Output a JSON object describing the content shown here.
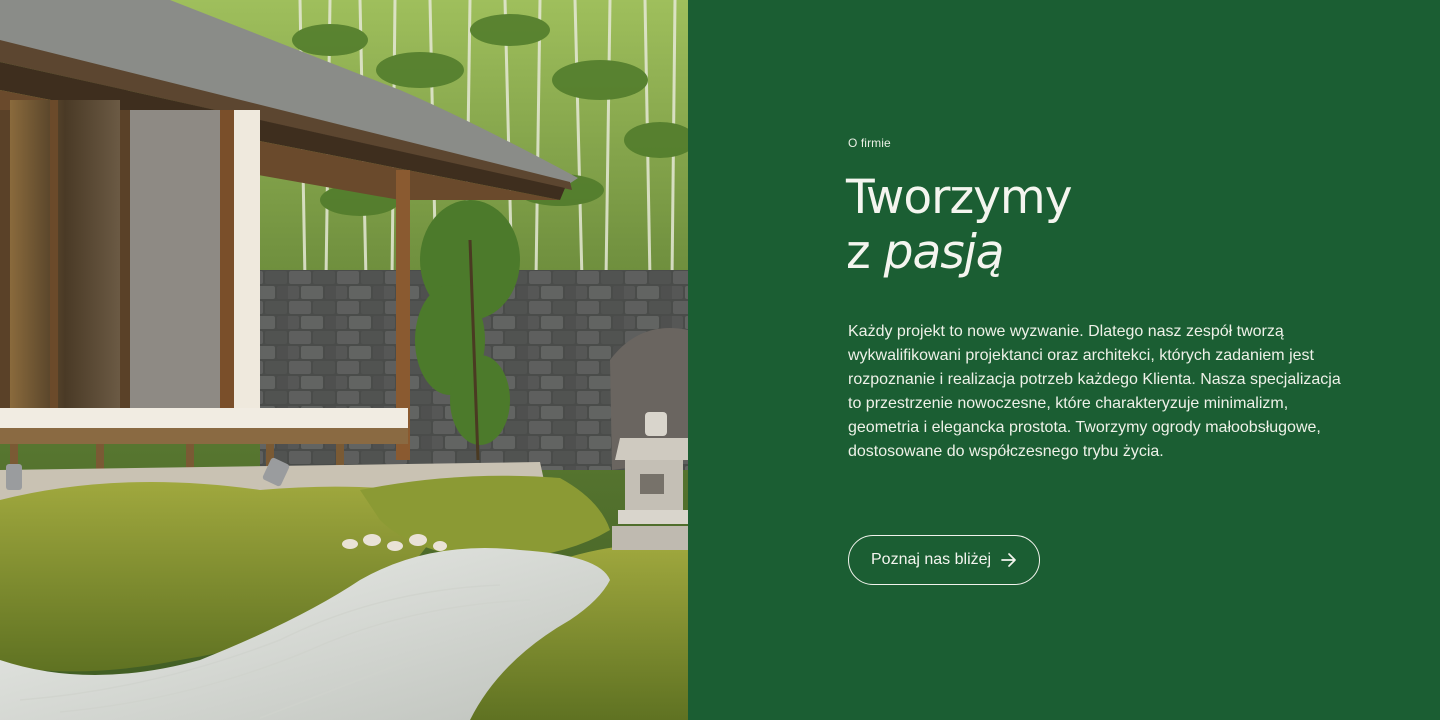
{
  "about": {
    "eyebrow": "O firmie",
    "heading_line1": "Tworzymy",
    "heading_line2_prefix": "z",
    "heading_line2_accent": "pasją",
    "body": "Każdy projekt to nowe wyzwanie. Dlatego nasz zespół tworzą wykwalifikowani projektanci oraz architekci, których zadaniem jest rozpoznanie i realizacja potrzeb każdego Klienta. Nasza specjalizacja to przestrzenie nowoczesne, które charakteryzuje minimalizm, geometria i elegancka prostota. Tworzymy ogrody małoobsługowe, dostosowane do współczesnego trybu życia.",
    "cta_label": "Poznaj nas bliżej",
    "cta_icon": "arrow-right-icon"
  },
  "photo": {
    "subject": "japanese-garden-photo"
  },
  "colors": {
    "panel_bg": "#1b5e33",
    "text": "#f1f3ec",
    "moss": "#7a8f32",
    "gravel": "#d8dad6"
  }
}
